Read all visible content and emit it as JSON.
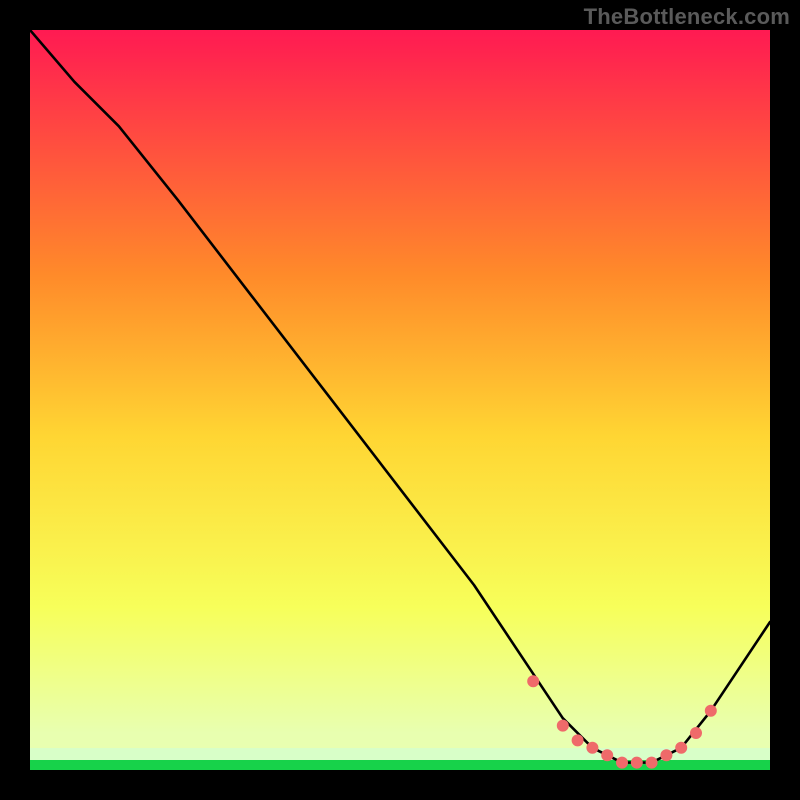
{
  "watermark": "TheBottleneck.com",
  "colors": {
    "bg": "#000000",
    "gradient_top": "#ff1a52",
    "gradient_mid1": "#ff8a2a",
    "gradient_mid2": "#ffd633",
    "gradient_mid3": "#f7ff5a",
    "gradient_bottom": "#e8ffb0",
    "green_band": "#17d24a",
    "curve": "#000000",
    "marker_fill": "#ef6a6a",
    "marker_stroke": "#ef6a6a"
  },
  "chart_data": {
    "type": "line",
    "title": "",
    "xlabel": "",
    "ylabel": "",
    "xlim": [
      0,
      100
    ],
    "ylim": [
      0,
      100
    ],
    "note": "Axes and units are not labeled in the source image; x/y values below are read off pixel gridlines and normalized to 0–100. y = 100 is the top of the plot area, y = 0 is the bottom.",
    "series": [
      {
        "name": "curve",
        "x": [
          0,
          6,
          12,
          20,
          30,
          40,
          50,
          60,
          68,
          72,
          76,
          80,
          84,
          88,
          92,
          100
        ],
        "y": [
          100,
          93,
          87,
          77,
          64,
          51,
          38,
          25,
          13,
          7,
          3,
          1,
          1,
          3,
          8,
          20
        ]
      }
    ],
    "markers": {
      "name": "highlight-points",
      "x": [
        68,
        72,
        74,
        76,
        78,
        80,
        82,
        84,
        86,
        88,
        90,
        92
      ],
      "y": [
        12,
        6,
        4,
        3,
        2,
        1,
        1,
        1,
        2,
        3,
        5,
        8
      ]
    }
  }
}
